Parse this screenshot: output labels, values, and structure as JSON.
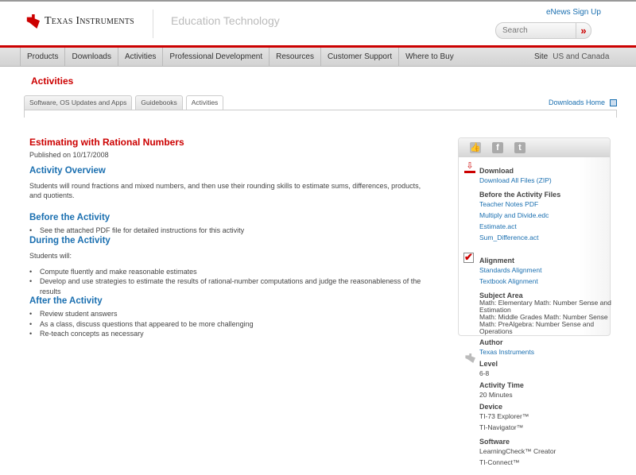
{
  "header": {
    "brand": "Texas Instruments",
    "section": "Education Technology",
    "enews": "eNews Sign Up",
    "search_placeholder": "Search",
    "search_go": "»"
  },
  "nav": {
    "items": [
      "Products",
      "Downloads",
      "Activities",
      "Professional Development",
      "Resources",
      "Customer Support",
      "Where to Buy"
    ],
    "site_label": "Site",
    "site_value": "US and Canada"
  },
  "page_title": "Activities",
  "tabs": [
    "Software, OS Updates and Apps",
    "Guidebooks",
    "Activities"
  ],
  "downloads_home": "Downloads Home",
  "main": {
    "title": "Estimating with Rational Numbers",
    "published": "Published on 10/17/2008",
    "overview_h": "Activity Overview",
    "overview": "Students will round fractions and mixed numbers, and then use their rounding skills to estimate sums, differences, products, and quotients.",
    "before_h": "Before the Activity",
    "before": [
      "See the attached PDF file for detailed instructions for this activity"
    ],
    "during_h": "During the Activity",
    "during_intro": "Students will:",
    "during": [
      "Compute fluently and make reasonable estimates",
      "Develop and use strategies to estimate the results of rational-number computations and judge the reasonableness of the results"
    ],
    "after_h": "After the Activity",
    "after": [
      "Review student answers",
      "As a class, discuss questions that appeared to be more challenging",
      "Re-teach concepts as necessary"
    ]
  },
  "sidebar": {
    "download_h": "Download",
    "download_all": "Download All Files (ZIP)",
    "before_files_h": "Before the Activity Files",
    "files": [
      "Teacher Notes PDF",
      "Multiply and Divide.edc",
      "Estimate.act",
      "Sum_Difference.act"
    ],
    "alignment_h": "Alignment",
    "alignment": [
      "Standards Alignment",
      "Textbook Alignment"
    ],
    "subject_h": "Subject Area",
    "subjects": [
      "Math: Elementary Math: Number Sense and Estimation",
      "Math: Middle Grades Math: Number Sense",
      "Math: PreAlgebra: Number Sense and Operations"
    ],
    "author_h": "Author",
    "author": "Texas Instruments",
    "level_h": "Level",
    "level": "6-8",
    "time_h": "Activity Time",
    "time": "20 Minutes",
    "device_h": "Device",
    "devices": [
      "TI-73 Explorer™",
      "TI-Navigator™"
    ],
    "software_h": "Software",
    "software": [
      "LearningCheck™ Creator",
      "TI-Connect™"
    ]
  }
}
